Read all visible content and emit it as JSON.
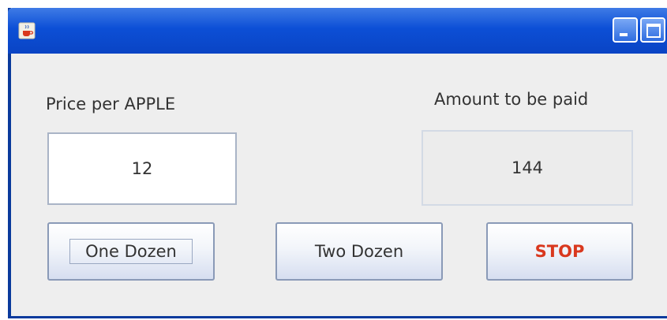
{
  "window": {
    "title": "",
    "controls": {
      "minimize_icon": "minimize-icon",
      "maximize_icon": "maximize-icon",
      "close_icon": "close-icon"
    },
    "app_icon": "java-cup-icon"
  },
  "form": {
    "price_label": "Price per APPLE",
    "price_value": "12",
    "amount_label": "Amount to be paid",
    "amount_value": "144"
  },
  "buttons": {
    "one_dozen": "One Dozen",
    "two_dozen": "Two Dozen",
    "stop": "STOP"
  },
  "colors": {
    "titlebar": "#0c4fd6",
    "stop_text": "#d9381e",
    "panel": "#eeeeee"
  }
}
